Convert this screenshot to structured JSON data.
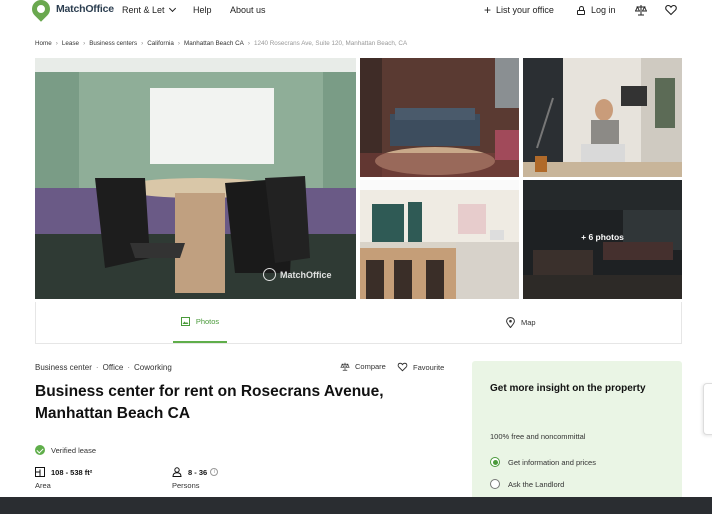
{
  "header": {
    "logo_text": "MatchOffice",
    "nav_rent": "Rent & Let",
    "nav_help": "Help",
    "nav_about": "About us",
    "list_office": "List your office",
    "login": "Log in"
  },
  "breadcrumb": [
    "Home",
    "Lease",
    "Business centers",
    "California",
    "Manhattan Beach CA",
    "1240 Rosecrans Ave, Suite 120, Manhattan Beach, CA"
  ],
  "gallery": {
    "more_photos": "+ 6 photos",
    "watermark": "MatchOffice"
  },
  "tabs": {
    "photos": "Photos",
    "map": "Map"
  },
  "listing": {
    "types": [
      "Business center",
      "Office",
      "Coworking"
    ],
    "compare": "Compare",
    "favourite": "Favourite",
    "title": "Business center for rent on Rosecrans Avenue, Manhattan Beach CA",
    "verified": "Verified lease",
    "area_value": "108 - 538 ft²",
    "area_label": "Area",
    "persons_value": "8 - 36",
    "persons_label": "Persons"
  },
  "panel": {
    "title": "Get more insight on the property",
    "subtitle": "100% free and noncommittal",
    "option_1": "Get information and prices",
    "option_2": "Ask the Landlord"
  },
  "colors": {
    "accent": "#5fae4a",
    "panel_bg": "#eaf5e5"
  }
}
